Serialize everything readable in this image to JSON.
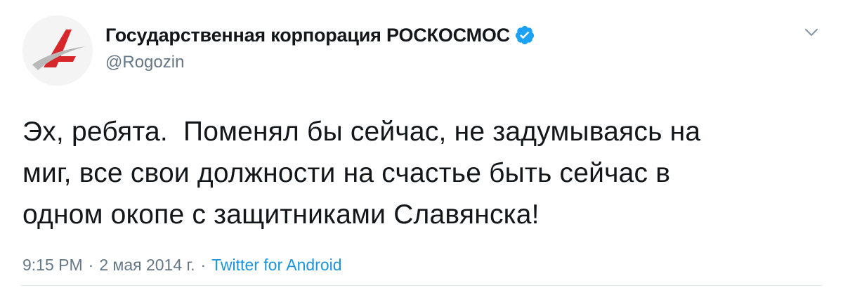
{
  "tweet": {
    "author": {
      "display_name": "Государственная корпорация РОСКОСМОС",
      "handle": "@Rogozin",
      "avatar_icon": "roscosmos-logo-icon",
      "verified": true,
      "verified_color": "#1da1f2"
    },
    "menu_icon": "chevron-down-icon",
    "text": "Эх, ребята.  Поменял бы сейчас, не задумываясь на\nмиг, все свои должности на счастье быть сейчас в\nодном окопе с защитниками Славянска!",
    "meta": {
      "time": "9:15 PM",
      "separator": "·",
      "date": "2 мая 2014 г.",
      "source": "Twitter for Android"
    },
    "colors": {
      "text": "#14171a",
      "secondary": "#657786",
      "link": "#1b95e0",
      "logo_red": "#d6282b"
    }
  }
}
